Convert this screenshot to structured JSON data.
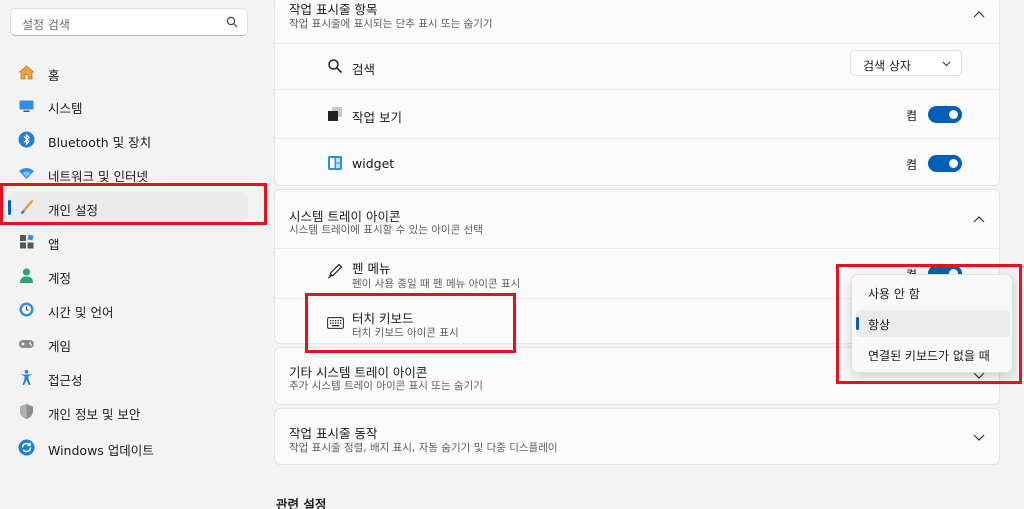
{
  "search": {
    "placeholder": "설정 검색",
    "icon": "search-icon"
  },
  "sidebar": {
    "items": [
      {
        "label": "홈",
        "icon": "home-icon"
      },
      {
        "label": "시스템",
        "icon": "system-icon"
      },
      {
        "label": "Bluetooth 및 장치",
        "icon": "bluetooth-icon"
      },
      {
        "label": "네트워크 및 인터넷",
        "icon": "wifi-icon"
      },
      {
        "label": "개인 설정",
        "icon": "brush-icon",
        "active": true
      },
      {
        "label": "앱",
        "icon": "apps-icon"
      },
      {
        "label": "계정",
        "icon": "account-icon"
      },
      {
        "label": "시간 및 언어",
        "icon": "clock-globe-icon"
      },
      {
        "label": "게임",
        "icon": "gamepad-icon"
      },
      {
        "label": "접근성",
        "icon": "accessibility-icon"
      },
      {
        "label": "개인 정보 및 보안",
        "icon": "shield-icon"
      },
      {
        "label": "Windows 업데이트",
        "icon": "update-icon"
      }
    ]
  },
  "taskbar_items": {
    "title": "작업 표시줄 항목",
    "subtitle": "작업 표시줄에 표시되는 단추 표시 또는 숨기기",
    "rows": [
      {
        "label": "검색",
        "icon": "search-icon",
        "control": "dropdown",
        "value": "검색 상자"
      },
      {
        "label": "작업 보기",
        "icon": "task-view-icon",
        "control": "toggle",
        "state": "켬",
        "on": true
      },
      {
        "label": "widget",
        "icon": "widget-icon",
        "control": "toggle",
        "state": "켬",
        "on": true
      }
    ]
  },
  "tray_icons": {
    "title": "시스템 트레이 아이콘",
    "subtitle": "시스템 트레이에 표시할 수 있는 아이콘 선택",
    "rows": [
      {
        "label": "펜 메뉴",
        "sub": "펜이 사용 중일 때 펜 메뉴 아이콘 표시",
        "icon": "pen-icon",
        "state": "켬"
      },
      {
        "label": "터치 키보드",
        "sub": "터치 키보드 아이콘 표시",
        "icon": "keyboard-icon"
      }
    ]
  },
  "touch_keyboard_menu": {
    "options": [
      "사용 안 함",
      "항상",
      "연결된 키보드가 없을 때"
    ],
    "selected": "항상"
  },
  "other_tray": {
    "title": "기타 시스템 트레이 아이콘",
    "subtitle": "추가 시스템 트레이 아이콘 표시 또는 숨기기"
  },
  "taskbar_behavior": {
    "title": "작업 표시줄 동작",
    "subtitle": "작업 표시줄 정렬, 배지 표시, 자동 숨기기 및 다중 디스플레이"
  },
  "related": {
    "title": "관련 설정"
  },
  "colors": {
    "accent": "#005fb8",
    "annotation": "#e0141e"
  }
}
